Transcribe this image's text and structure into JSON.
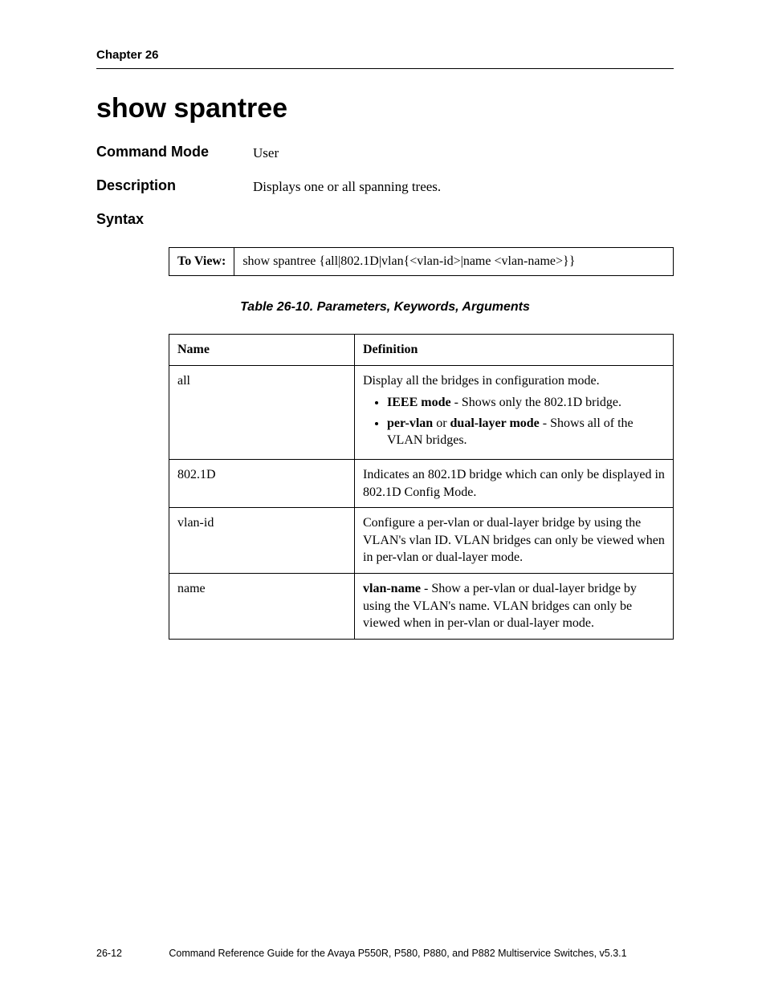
{
  "header": {
    "chapter": "Chapter 26"
  },
  "title": "show spantree",
  "commandMode": {
    "label": "Command Mode",
    "value": "User"
  },
  "description": {
    "label": "Description",
    "value": "Displays one or all spanning trees."
  },
  "syntax": {
    "label": "Syntax",
    "rowLabel": "To View:",
    "rowValue": "show spantree {all|802.1D|vlan{<vlan-id>|name <vlan-name>}}"
  },
  "paramTable": {
    "caption": "Table 26-10.  Parameters, Keywords, Arguments",
    "headers": {
      "name": "Name",
      "definition": "Definition"
    },
    "rows": {
      "all": {
        "name": "all",
        "defLead": "Display all the bridges in configuration mode.",
        "bullet1_b": "IEEE mode",
        "bullet1_rest": " - Shows only the 802.1D bridge.",
        "bullet2_b1": "per-vlan",
        "bullet2_mid": " or ",
        "bullet2_b2": "dual-layer mode",
        "bullet2_rest": " - Shows all of the VLAN bridges."
      },
      "d8021": {
        "name": "802.1D",
        "def": "Indicates an 802.1D bridge which can only be displayed in 802.1D Config Mode."
      },
      "vlanid": {
        "name": "vlan-id",
        "def": "Configure a per-vlan or dual-layer bridge by using the VLAN's vlan ID. VLAN bridges can only be viewed when in per-vlan or dual-layer mode."
      },
      "namerow": {
        "name": "name",
        "def_b": "vlan-name",
        "def_rest": " - Show a per-vlan or dual-layer bridge by using the VLAN's name. VLAN bridges can only be viewed when in per-vlan or dual-layer mode."
      }
    }
  },
  "footer": {
    "page": "26-12",
    "title": "Command Reference Guide for the Avaya P550R, P580, P880, and P882 Multiservice Switches, v5.3.1"
  }
}
